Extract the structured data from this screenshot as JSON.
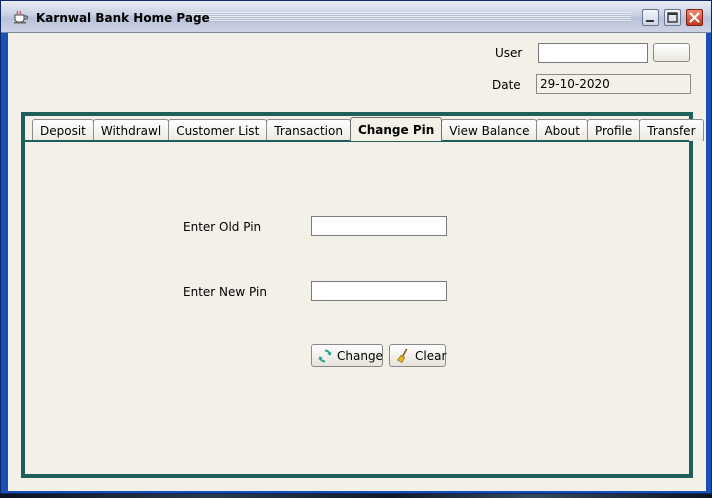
{
  "window": {
    "title": "Karnwal Bank Home Page",
    "icons": {
      "app": "coffee-cup-icon",
      "minimize": "minimize-icon",
      "maximize": "maximize-icon",
      "close": "close-icon"
    }
  },
  "header": {
    "user_label": "User",
    "user_value": "",
    "date_label": "Date",
    "date_value": "29-10-2020"
  },
  "tabs": [
    {
      "label": "Deposit",
      "active": false
    },
    {
      "label": "Withdrawl",
      "active": false
    },
    {
      "label": "Customer List",
      "active": false
    },
    {
      "label": "Transaction",
      "active": false
    },
    {
      "label": "Change Pin",
      "active": true
    },
    {
      "label": "View Balance",
      "active": false
    },
    {
      "label": "About",
      "active": false
    },
    {
      "label": "Profile",
      "active": false
    },
    {
      "label": "Transfer",
      "active": false
    }
  ],
  "change_pin": {
    "old_pin_label": "Enter Old Pin",
    "old_pin_value": "",
    "new_pin_label": "Enter New Pin",
    "new_pin_value": "",
    "change_label": "Change",
    "change_icon": "refresh-icon",
    "clear_label": "Clear",
    "clear_icon": "broom-icon"
  },
  "colors": {
    "panel_border": "#1f5f5b",
    "background": "#f3f0e8"
  }
}
